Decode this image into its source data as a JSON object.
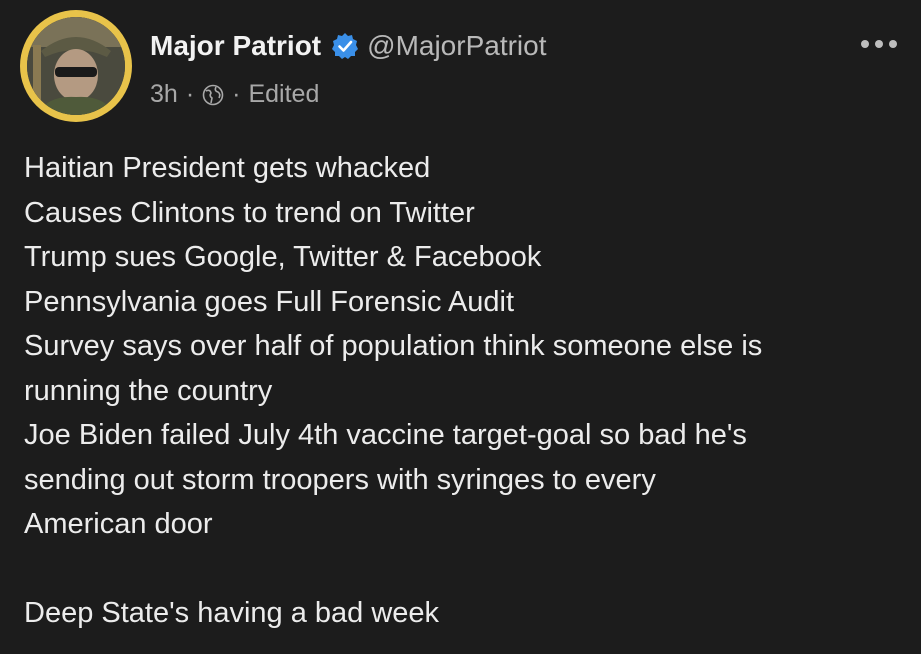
{
  "author": {
    "display_name": "Major Patriot",
    "handle": "@MajorPatriot",
    "verified": true,
    "avatar_border_color": "#e8c34a"
  },
  "meta": {
    "time": "3h",
    "separator": "·",
    "audience_icon": "globe-icon",
    "edited_label": "Edited"
  },
  "menu": {
    "icon": "more-options-icon"
  },
  "post": {
    "lines": [
      "Haitian President gets whacked",
      "Causes Clintons to trend on Twitter",
      "Trump sues Google, Twitter & Facebook",
      "Pennsylvania goes Full Forensic Audit",
      "Survey says over half of population think someone else is",
      "running the country",
      "Joe Biden failed July 4th vaccine target-goal so bad he's",
      "sending out storm troopers with syringes to every",
      "American door",
      "",
      "Deep State's having a bad week"
    ]
  },
  "colors": {
    "background": "#1c1c1c",
    "text": "#ececec",
    "secondary_text": "#a8a8a8",
    "verified_badge": "#3a8fe8"
  }
}
